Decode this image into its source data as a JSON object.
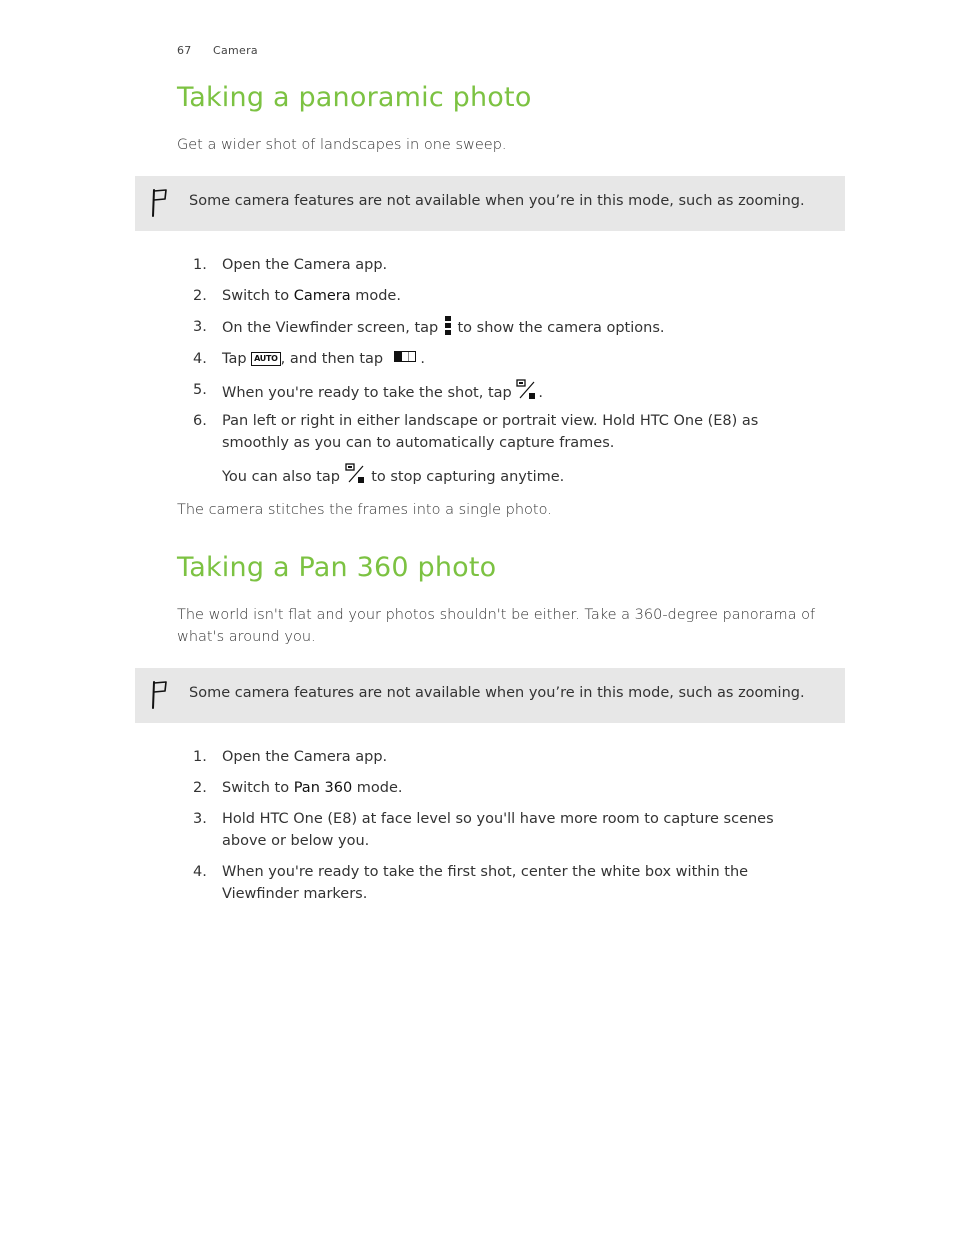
{
  "header": {
    "page_number": "67",
    "chapter": "Camera"
  },
  "section1": {
    "title": "Taking a panoramic photo",
    "intro": "Get a wider shot of landscapes in one sweep.",
    "note": {
      "icon": "flag-icon",
      "text": "Some camera features are not available when you’re in this mode, such as zooming."
    },
    "steps": [
      {
        "num": "1.",
        "text": "Open the Camera app."
      },
      {
        "num": "2.",
        "pre": "Switch to ",
        "strong": "Camera",
        "post": " mode."
      },
      {
        "num": "3.",
        "pre": "On the Viewfinder screen, tap ",
        "icon": "more-options-icon",
        "post": " to show the camera options."
      },
      {
        "num": "4.",
        "pre": "Tap ",
        "icon1": "auto-mode-icon",
        "icon1_label": "AUTO",
        "mid": ", and then tap ",
        "icon2": "panorama-mode-icon",
        "post": " ."
      },
      {
        "num": "5.",
        "pre": "When you're ready to take the shot, tap ",
        "icon": "shutter-stop-icon",
        "post": "."
      },
      {
        "num": "6.",
        "text": "Pan left or right in either landscape or portrait view. Hold HTC One (E8) as smoothly as you can to automatically capture frames.",
        "sub_pre": "You can also tap ",
        "sub_icon": "shutter-stop-icon",
        "sub_post": " to stop capturing anytime."
      }
    ],
    "outro": "The camera stitches the frames into a single photo."
  },
  "section2": {
    "title": "Taking a Pan 360 photo",
    "intro": "The world isn't flat and your photos shouldn't be either. Take a 360-degree panorama of what's around you.",
    "note": {
      "icon": "flag-icon",
      "text": "Some camera features are not available when you’re in this mode, such as zooming."
    },
    "steps": [
      {
        "num": "1.",
        "text": "Open the Camera app."
      },
      {
        "num": "2.",
        "pre": "Switch to ",
        "strong": "Pan 360",
        "post": " mode."
      },
      {
        "num": "3.",
        "text": "Hold HTC One (E8) at face level so you'll have more room to capture scenes above or below you."
      },
      {
        "num": "4.",
        "text": "When you're ready to take the first shot, center the white box within the Viewfinder markers."
      }
    ]
  },
  "colors": {
    "heading": "#7cc242",
    "note_bg": "#e7e7e7",
    "body_text": "#333333"
  }
}
